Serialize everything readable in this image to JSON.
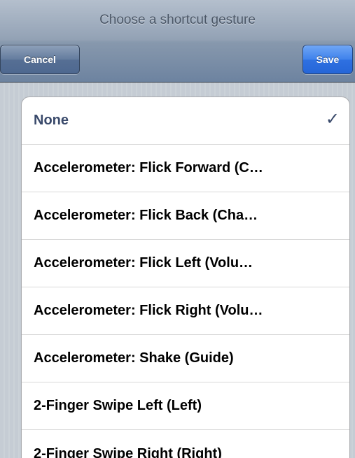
{
  "navbar": {
    "title": "Choose a shortcut gesture",
    "cancel_label": "Cancel",
    "save_label": "Save"
  },
  "gestures": [
    {
      "label": "None",
      "selected": true
    },
    {
      "label": "Accelerometer: Flick Forward (C…",
      "selected": false
    },
    {
      "label": "Accelerometer: Flick Back (Cha…",
      "selected": false
    },
    {
      "label": "Accelerometer: Flick Left (Volu…",
      "selected": false
    },
    {
      "label": "Accelerometer: Flick Right (Volu…",
      "selected": false
    },
    {
      "label": "Accelerometer: Shake (Guide)",
      "selected": false
    },
    {
      "label": "2-Finger Swipe Left (Left)",
      "selected": false
    },
    {
      "label": "2-Finger Swipe Right (Right)",
      "selected": false
    }
  ],
  "icons": {
    "selected_mark": "checkmark-icon"
  },
  "colors": {
    "save_button": "#2f70e1",
    "cancel_button": "#566f94",
    "selected_text": "#3a4a6b"
  }
}
